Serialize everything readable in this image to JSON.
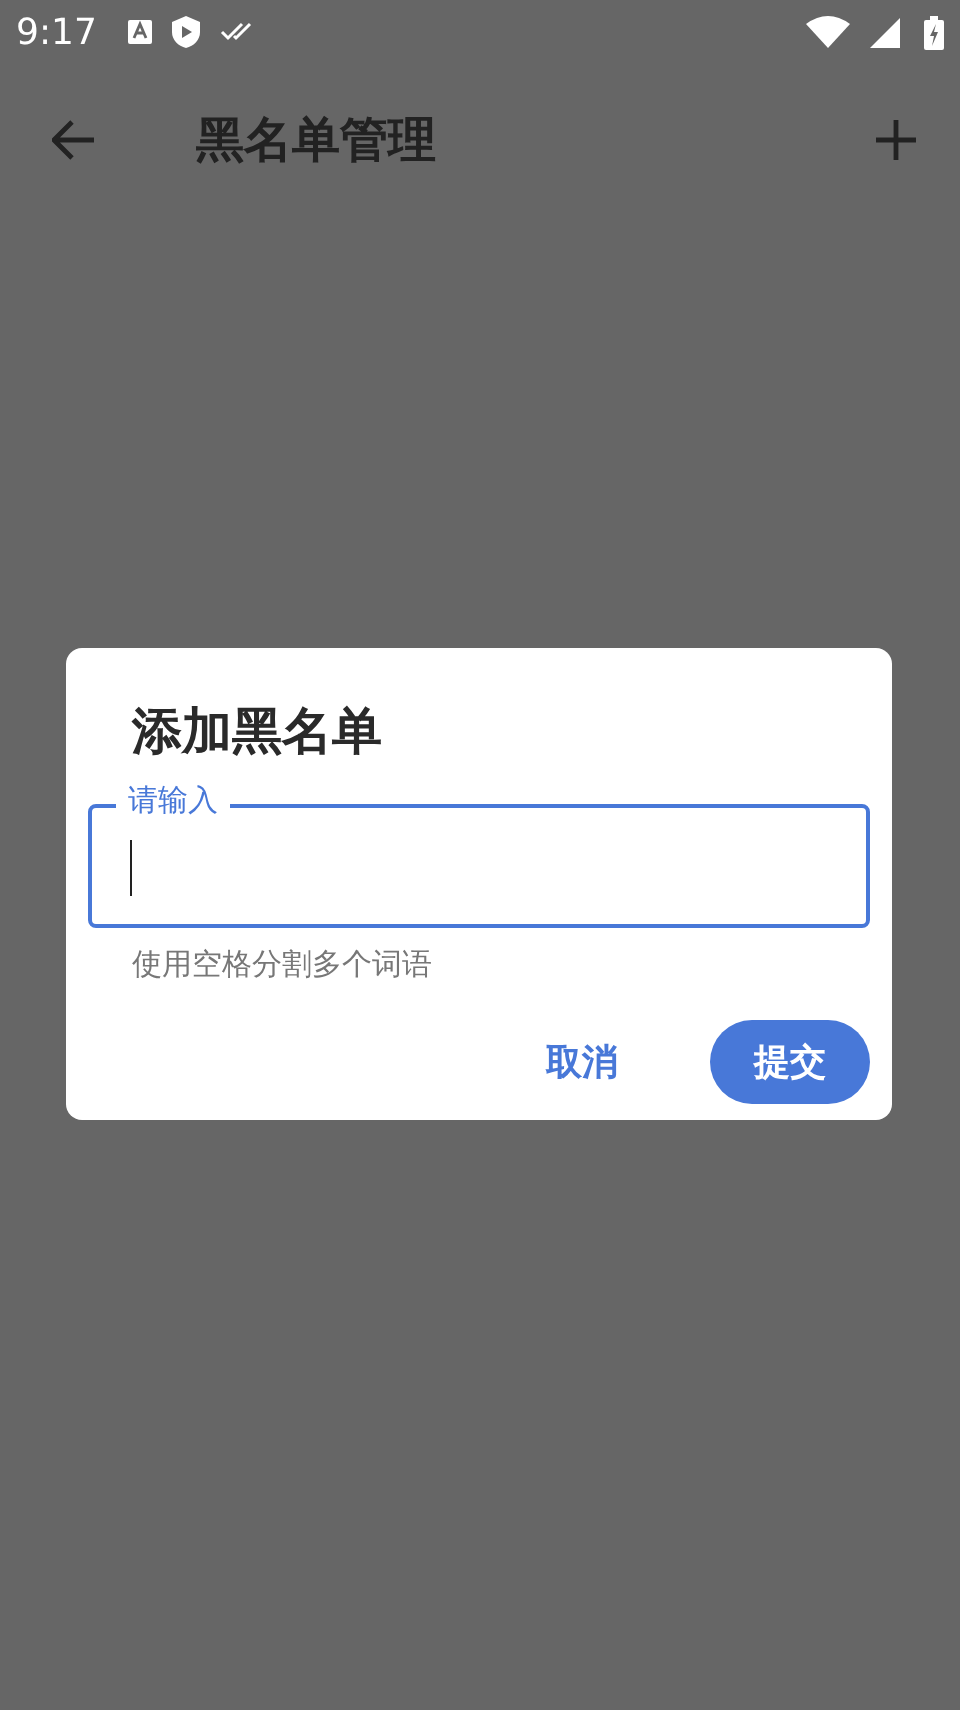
{
  "status_bar": {
    "time": "9:17"
  },
  "app_bar": {
    "title": "黑名单管理"
  },
  "dialog": {
    "title": "添加黑名单",
    "field": {
      "label": "请输入",
      "focused": true,
      "helper": "使用空格分割多个词语"
    },
    "buttons": [
      {
        "label": "取消",
        "kind": "text"
      },
      {
        "label": "提交",
        "kind": "filled"
      }
    ]
  }
}
